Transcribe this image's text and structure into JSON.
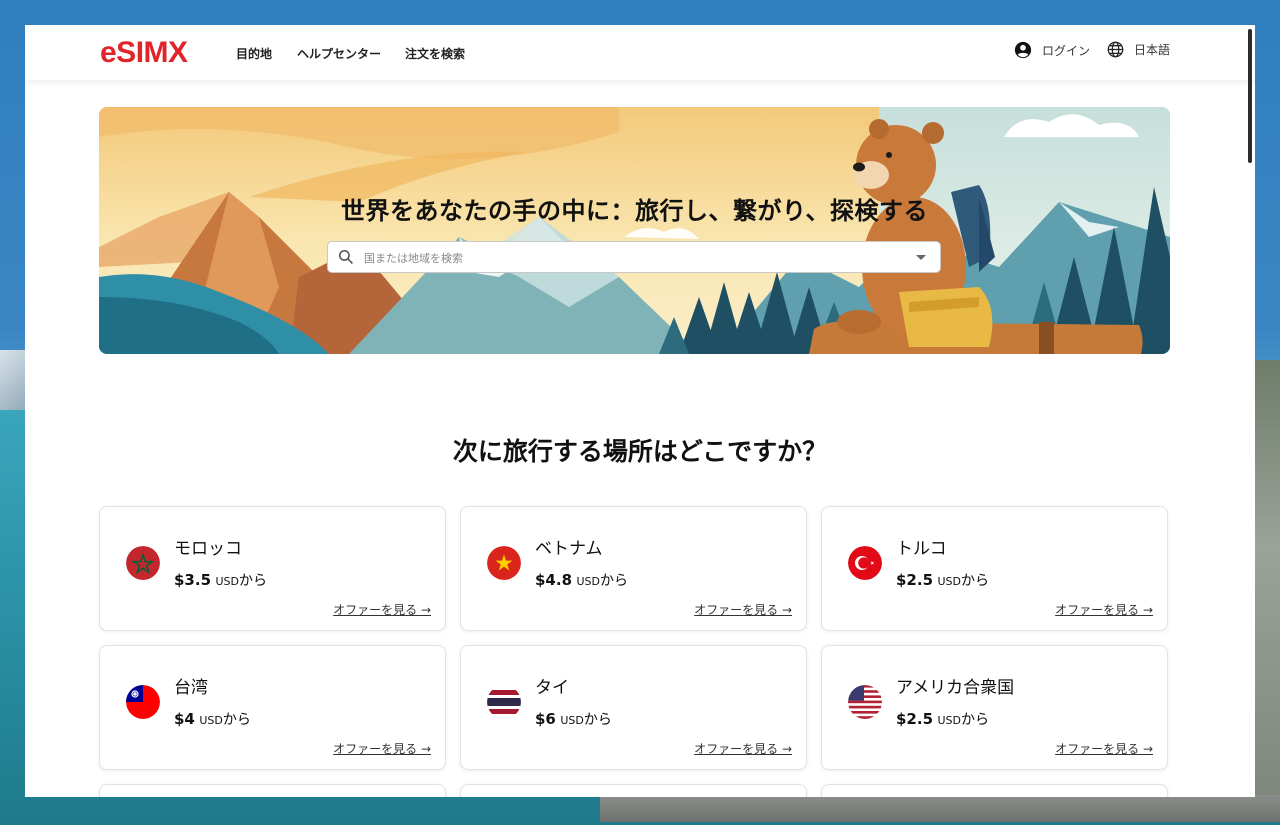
{
  "header": {
    "logo": "eSIMX",
    "nav": [
      "目的地",
      "ヘルプセンター",
      "注文を検索"
    ],
    "login_label": "ログイン",
    "language_label": "日本語"
  },
  "hero": {
    "title": "世界をあなたの手の中に：旅行し、繋がり、探検する",
    "search_placeholder": "国または地域を検索"
  },
  "section_title": "次に旅行する場所はどこですか？",
  "offer_label": "オファーを見る →",
  "destinations": [
    {
      "name": "モロッコ",
      "price": "$3.5",
      "currency": "USD",
      "suffix": "から",
      "flag": "morocco-flag-icon"
    },
    {
      "name": "ベトナム",
      "price": "$4.8",
      "currency": "USD",
      "suffix": "から",
      "flag": "vietnam-flag-icon"
    },
    {
      "name": "トルコ",
      "price": "$2.5",
      "currency": "USD",
      "suffix": "から",
      "flag": "turkey-flag-icon"
    },
    {
      "name": "台湾",
      "price": "$4",
      "currency": "USD",
      "suffix": "から",
      "flag": "taiwan-flag-icon"
    },
    {
      "name": "タイ",
      "price": "$6",
      "currency": "USD",
      "suffix": "から",
      "flag": "thailand-flag-icon"
    },
    {
      "name": "アメリカ合衆国",
      "price": "$2.5",
      "currency": "USD",
      "suffix": "から",
      "flag": "usa-flag-icon"
    }
  ],
  "colors": {
    "brand": "#e0242a",
    "hero_sky": "#f6d98a"
  }
}
